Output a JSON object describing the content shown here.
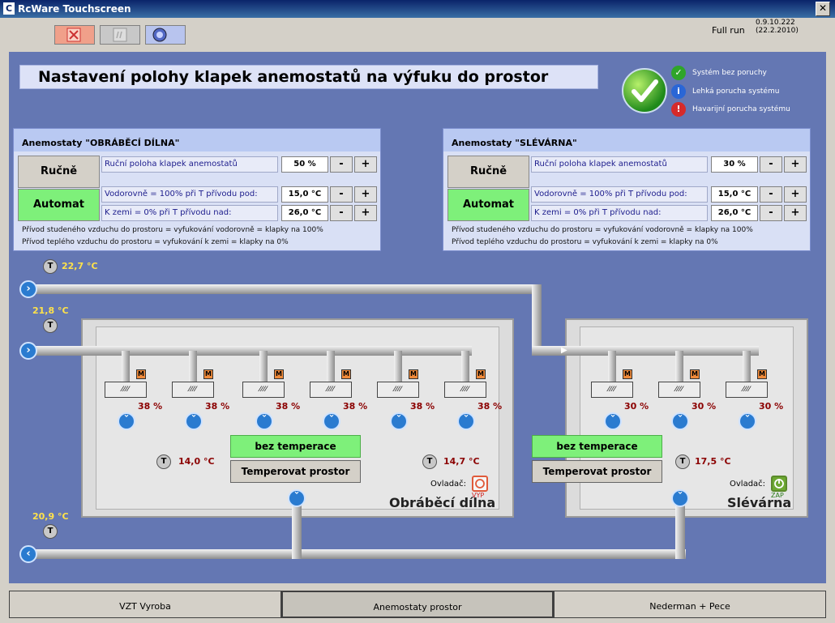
{
  "window": {
    "title": "RcWare Touchscreen",
    "app_icon": "C",
    "close_glyph": "✕"
  },
  "header": {
    "status": "Full run",
    "version": "0.9.10.222 (22.2.2010)"
  },
  "page_title": "Nastavení polohy klapek anemostatů na výfuku do prostor",
  "status_legend": [
    {
      "label": "Systém bez poruchy",
      "color": "#2fa52a",
      "glyph": "✓"
    },
    {
      "label": "Lehká porucha systému",
      "color": "#2a66d6",
      "glyph": "i"
    },
    {
      "label": "Havarijní porucha systému",
      "color": "#d62a2a",
      "glyph": "!"
    }
  ],
  "panels": [
    {
      "title": "Anemostaty \"OBRÁBĚCÍ DÍLNA\"",
      "manual_label": "Ručně",
      "auto_label": "Automat",
      "rows": [
        {
          "label": "Ruční poloha klapek anemostatů",
          "value": "50 %"
        },
        {
          "label": "Vodorovně  = 100% při T přívodu pod:",
          "value": "15,0 °C"
        },
        {
          "label": "K zemi = 0% při T přívodu nad:",
          "value": "26,0 °C"
        }
      ],
      "notes": [
        "Přívod studeného vzduchu do prostoru = vyfukování vodorovně = klapky na 100%",
        "Přívod teplého vzduchu do prostoru = vyfukování k zemi = klapky na 0%"
      ]
    },
    {
      "title": "Anemostaty \"SLÉVÁRNA\"",
      "manual_label": "Ručně",
      "auto_label": "Automat",
      "rows": [
        {
          "label": "Ruční poloha klapek anemostatů",
          "value": "30 %"
        },
        {
          "label": "Vodorovně  = 100% při T přívodu pod:",
          "value": "15,0 °C"
        },
        {
          "label": "K zemi = 0% při T přívodu nad:",
          "value": "26,0 °C"
        }
      ],
      "notes": [
        "Přívod studeného vzduchu do prostoru = vyfukování vodorovně = klapky na 100%",
        "Přívod teplého vzduchu do prostoru = vyfukování k zemi = klapky na 0%"
      ]
    }
  ],
  "controls": {
    "minus": "-",
    "plus": "+"
  },
  "sensors": {
    "symbol": "T",
    "t_top": "22,7 °C",
    "t_supply": "21,8 °C",
    "t_return": "20,9 °C"
  },
  "damper": {
    "motor": "M",
    "pattern": "⁄⁄⁄⁄"
  },
  "room1": {
    "name": "Obráběcí dílna",
    "damper_pct": [
      "38 %",
      "38 %",
      "38 %",
      "38 %",
      "38 %",
      "38 %"
    ],
    "temp_left": "14,0 °C",
    "temp_right": "14,7 °C",
    "temper_status": "bez temperace",
    "temper_button": "Temperovat prostor",
    "controller_label": "Ovladač:",
    "controller_state": "VYP"
  },
  "room2": {
    "name": "Slévárna",
    "damper_pct": [
      "30 %",
      "30 %",
      "30 %"
    ],
    "temp": "17,5 °C",
    "temper_status": "bez temperace",
    "temper_button": "Temperovat prostor",
    "controller_label": "Ovladač:",
    "controller_state": "ZAP"
  },
  "tabs": [
    "VZT Vyroba",
    "Anemostaty prostor",
    "Nederman + Pece"
  ]
}
